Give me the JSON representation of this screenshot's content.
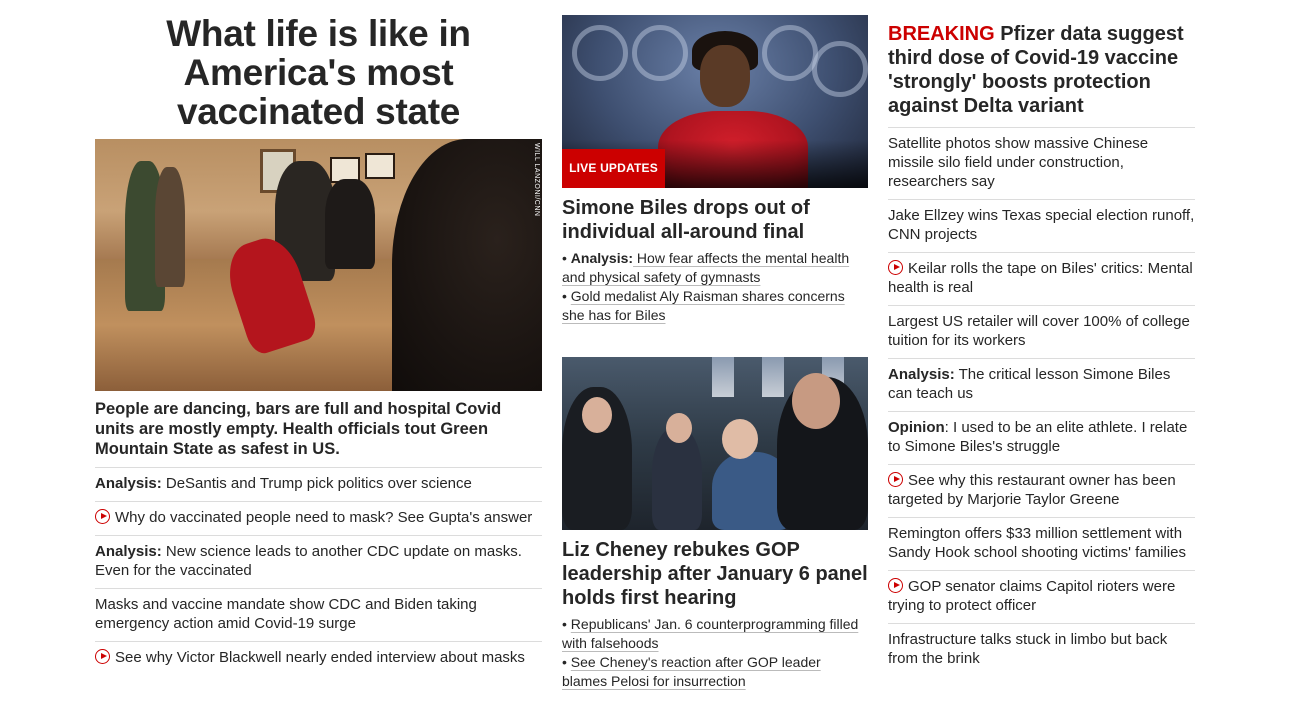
{
  "left": {
    "headline": "What life is like in America's most vaccinated state",
    "image_credit": "WILL LANZONI/CNN",
    "hero_caption": "People are dancing, bars are full and hospital Covid units are mostly empty. Health officials tout Green Mountain State as safest in US.",
    "items": [
      {
        "label": "Analysis:",
        "text": " DeSantis and Trump pick politics over science",
        "video": false
      },
      {
        "label": "",
        "text": "Why do vaccinated people need to mask? See Gupta's answer",
        "video": true
      },
      {
        "label": "Analysis:",
        "text": " New science leads to another CDC update on masks. Even for the vaccinated",
        "video": false
      },
      {
        "label": "",
        "text": "Masks and vaccine mandate show CDC and Biden taking emergency action amid Covid-19 surge",
        "video": false
      },
      {
        "label": "",
        "text": "See why Victor Blackwell nearly ended interview about masks",
        "video": true
      }
    ]
  },
  "middle": {
    "live_badge": "LIVE UPDATES",
    "story1": {
      "headline": "Simone Biles drops out of individual all-around final",
      "bullets": [
        {
          "prefix": "• ",
          "label": "Analysis:",
          "text": " How fear affects the mental health and physical safety of gymnasts"
        },
        {
          "prefix": "• ",
          "label": "",
          "text": "Gold medalist Aly Raisman shares concerns she has for Biles"
        }
      ]
    },
    "story2": {
      "headline": "Liz Cheney rebukes GOP leadership after January 6 panel holds first hearing",
      "bullets": [
        {
          "prefix": "• ",
          "label": "",
          "text": "Republicans' Jan. 6 counterprogramming filled with falsehoods"
        },
        {
          "prefix": "• ",
          "label": "",
          "text": "See Cheney's reaction after GOP leader blames Pelosi for insurrection"
        }
      ]
    }
  },
  "right": {
    "breaking_tag": "BREAKING",
    "breaking_headline": " Pfizer data suggest third dose of Covid-19 vaccine 'strongly' boosts protection against Delta variant",
    "items": [
      {
        "label": "",
        "text": "Satellite photos show massive Chinese missile silo field under construction, researchers say",
        "video": false
      },
      {
        "label": "",
        "text": "Jake Ellzey wins Texas special election runoff, CNN projects",
        "video": false
      },
      {
        "label": "",
        "text": "Keilar rolls the tape on Biles' critics: Mental health is real",
        "video": true
      },
      {
        "label": "",
        "text": "Largest US retailer will cover 100% of college tuition for its workers",
        "video": false
      },
      {
        "label": "Analysis:",
        "text": " The critical lesson Simone Biles can teach us",
        "video": false
      },
      {
        "label": "Opinion",
        "text": ": I used to be an elite athlete. I relate to Simone Biles's struggle",
        "video": false
      },
      {
        "label": "",
        "text": "See why this restaurant owner has been targeted by Marjorie Taylor Greene",
        "video": true
      },
      {
        "label": "",
        "text": "Remington offers $33 million settlement with Sandy Hook school shooting victims' families",
        "video": false
      },
      {
        "label": "",
        "text": "GOP senator claims Capitol rioters were trying to protect officer",
        "video": true
      },
      {
        "label": "",
        "text": "Infrastructure talks stuck in limbo but back from the brink",
        "video": false
      }
    ]
  },
  "colors": {
    "accent": "#cc0000",
    "text": "#262626",
    "divider": "#dcdcdc"
  }
}
